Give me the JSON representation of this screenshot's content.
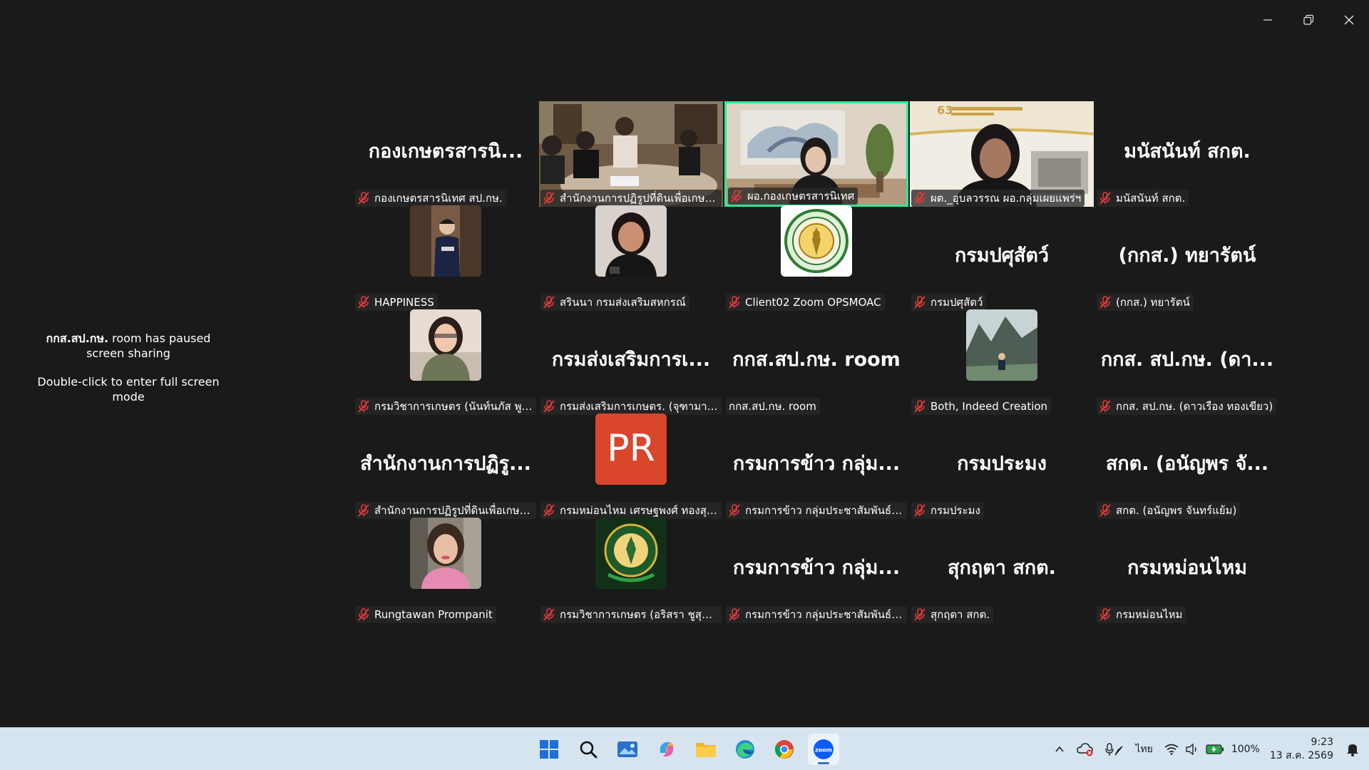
{
  "window_controls": {
    "minimize": "minimize-icon",
    "restore": "restore-icon",
    "close": "close-icon"
  },
  "paused_message": {
    "line1_bold": "กกส.สป.กษ.",
    "line1_rest": " room has paused screen sharing",
    "line2": "Double-click to enter full screen mode"
  },
  "participants": [
    {
      "name": "กองเกษตรสารนิเทศ สป.กษ.",
      "big": "กองเกษตรสารนิ...",
      "type": "name"
    },
    {
      "name": "สำนักงานการปฏิรูปที่ดินเพื่อเกษตรก...",
      "big": "",
      "type": "video-meeting"
    },
    {
      "name": "ผอ.กองเกษตรสารนิเทศ",
      "big": "",
      "type": "video-room",
      "active": true
    },
    {
      "name": "ผต._อุบลวรรณ ผอ.กลุ่มเผยแพร่ฯ",
      "big": "",
      "type": "video-person"
    },
    {
      "name": "มนัสนันท์ สกต.",
      "big": "มนัสนันท์ สกต.",
      "type": "name"
    },
    {
      "name": "HAPPINESS",
      "big": "",
      "type": "avatar-happiness"
    },
    {
      "name": "สรินนา กรมส่งเสริมสหกรณ์",
      "big": "",
      "type": "avatar-woman"
    },
    {
      "name": "Client02 Zoom OPSMOAC",
      "big": "",
      "type": "avatar-seal"
    },
    {
      "name": "กรมปศุสัตว์",
      "big": "กรมปศุสัตว์",
      "type": "name"
    },
    {
      "name": "(กกส.) ทยารัตน์",
      "big": "(กกส.) ทยารัตน์",
      "type": "name"
    },
    {
      "name": "กรมวิชาการเกษตร (นันท์นภัส พูลสวั...",
      "big": "",
      "type": "avatar-woman2"
    },
    {
      "name": "กรมส่งเสริมการเกษตร. (จุฑามาศ กรี...",
      "big": "กรมส่งเสริมการเ...",
      "type": "name"
    },
    {
      "name": "กกส.สป.กษ. room",
      "big": "กกส.สป.กษ. room",
      "type": "name",
      "nomic": true
    },
    {
      "name": "Both, Indeed Creation",
      "big": "",
      "type": "avatar-mountain"
    },
    {
      "name": "กกส. สป.กษ. (ดาวเรือง ทองเขียว)",
      "big": "กกส. สป.กษ. (ดา...",
      "type": "name"
    },
    {
      "name": "สำนักงานการปฏิรูปที่ดินเพื่อเกษตรก...",
      "big": "สำนักงานการปฏิรู...",
      "type": "name"
    },
    {
      "name": "กรมหม่อนไหม เศรษฐพงศ์ ทองสุข น...",
      "big": "PR",
      "type": "avatar-pr"
    },
    {
      "name": "กรมการข้าว กลุ่มประชาสัมพันธ์ (กวิ...",
      "big": "กรมการข้าว กลุ่ม...",
      "type": "name"
    },
    {
      "name": "กรมประมง",
      "big": "กรมประมง",
      "type": "name"
    },
    {
      "name": "สกต. (อนัญพร จันทร์แย้ม)",
      "big": "สกต. (อนัญพร จั...",
      "type": "name"
    },
    {
      "name": "Rungtawan Prompanit",
      "big": "",
      "type": "avatar-rung"
    },
    {
      "name": "กรมวิชาการเกษตร (อริสรา ชูสุวรรณ)",
      "big": "",
      "type": "avatar-emblem"
    },
    {
      "name": "กรมการข้าว กลุ่มประชาสัมพันธ์ (อุมา)",
      "big": "กรมการข้าว กลุ่ม...",
      "type": "name"
    },
    {
      "name": "สุกฤตา สกต.",
      "big": "สุกฤตา สกต.",
      "type": "name"
    },
    {
      "name": "กรมหม่อนไหม",
      "big": "กรมหม่อนไหม",
      "type": "name"
    }
  ],
  "taskbar": {
    "apps": [
      "start-icon",
      "search-icon",
      "photos-icon",
      "copilot-icon",
      "file-explorer-icon",
      "edge-icon",
      "chrome-icon",
      "zoom-icon"
    ],
    "tray": {
      "language": "ไทย",
      "battery": "100%",
      "time": "9:23",
      "date": "13 ส.ค. 2569"
    }
  }
}
